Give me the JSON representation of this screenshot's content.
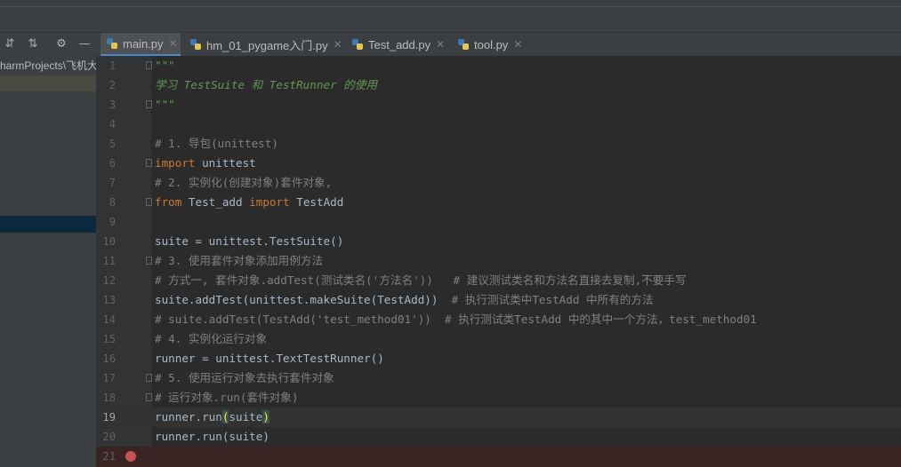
{
  "tabs": [
    {
      "label": "main.py",
      "active": true
    },
    {
      "label": "hm_01_pygame入门.py",
      "active": false
    },
    {
      "label": "Test_add.py",
      "active": false
    },
    {
      "label": "tool.py",
      "active": false
    }
  ],
  "project": {
    "path": "harmProjects\\飞机大战"
  },
  "code": {
    "l1": "\"\"\"",
    "l2": "学习 TestSuite 和 TestRunner 的使用",
    "l3": "\"\"\"",
    "l5": "# 1. 导包(unittest)",
    "l6_kw": "import",
    "l6_rest": " unittest",
    "l7": "# 2. 实例化(创建对象)套件对象,",
    "l8_kw1": "from",
    "l8_mid": " Test_add ",
    "l8_kw2": "import",
    "l8_rest": " TestAdd",
    "l10": "suite = unittest.TestSuite()",
    "l11": "# 3. 使用套件对象添加用例方法",
    "l12": "# 方式一, 套件对象.addTest(测试类名('方法名'))   # 建议测试类名和方法名直接去复制,不要手写",
    "l13_code": "suite.addTest(unittest.makeSuite(TestAdd))  ",
    "l13_cm": "# 执行测试类中TestAdd 中所有的方法",
    "l14": "# suite.addTest(TestAdd('test_method01'))  # 执行测试类TestAdd 中的其中一个方法，test_method01",
    "l15": "# 4. 实例化运行对象",
    "l16": "runner = unittest.TextTestRunner()",
    "l17": "# 5. 使用运行对象去执行套件对象",
    "l18": "# 运行对象.run(套件对象)",
    "l19_a": "runner.run",
    "l19_b": "(",
    "l19_c": "suite",
    "l19_d": ")",
    "l20": "runner.run(suite)"
  },
  "line_numbers": [
    "1",
    "2",
    "3",
    "4",
    "5",
    "6",
    "7",
    "8",
    "9",
    "10",
    "11",
    "12",
    "13",
    "14",
    "15",
    "16",
    "17",
    "18",
    "19",
    "20",
    "21"
  ],
  "colors": {
    "keyword": "#cc7832",
    "comment": "#808080",
    "docstring": "#629755",
    "breakpoint": "#c75450",
    "active_tab_underline": "#4a88c7"
  }
}
